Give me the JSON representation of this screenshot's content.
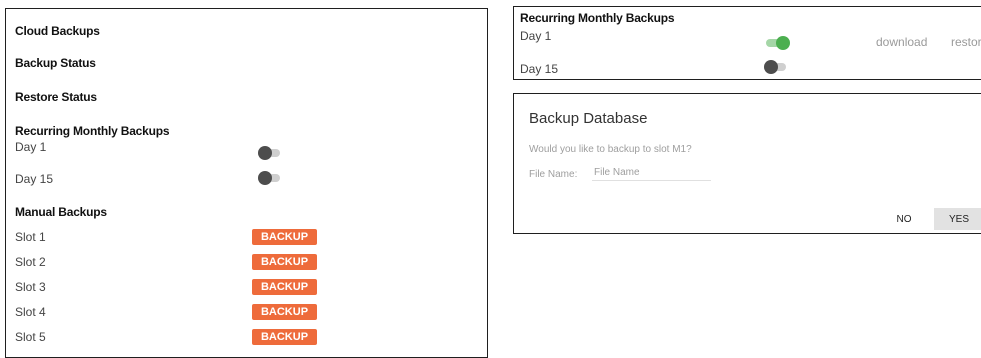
{
  "left": {
    "cloud_backups": "Cloud Backups",
    "backup_status": "Backup Status",
    "restore_status": "Restore Status",
    "recurring_heading": "Recurring Monthly Backups",
    "recurring": [
      {
        "label": "Day 1",
        "enabled": false
      },
      {
        "label": "Day 15",
        "enabled": false
      }
    ],
    "manual_heading": "Manual Backups",
    "slots": [
      {
        "label": "Slot 1",
        "button": "BACKUP"
      },
      {
        "label": "Slot 2",
        "button": "BACKUP"
      },
      {
        "label": "Slot 3",
        "button": "BACKUP"
      },
      {
        "label": "Slot 4",
        "button": "BACKUP"
      },
      {
        "label": "Slot 5",
        "button": "BACKUP"
      }
    ]
  },
  "right": {
    "recurring_heading": "Recurring Monthly Backups",
    "rows": [
      {
        "label": "Day 1",
        "enabled": true,
        "download": "download",
        "restore": "restore"
      },
      {
        "label": "Day 15",
        "enabled": false
      }
    ]
  },
  "dialog": {
    "title": "Backup Database",
    "message": "Would you like to backup to slot M1?",
    "field_label": "File Name:",
    "field_placeholder": "File Name",
    "field_value": "",
    "no_label": "NO",
    "yes_label": "YES"
  },
  "colors": {
    "accent": "#ee6b3b",
    "toggle_on": "#4caf50",
    "toggle_off": "#4d4d4d"
  }
}
